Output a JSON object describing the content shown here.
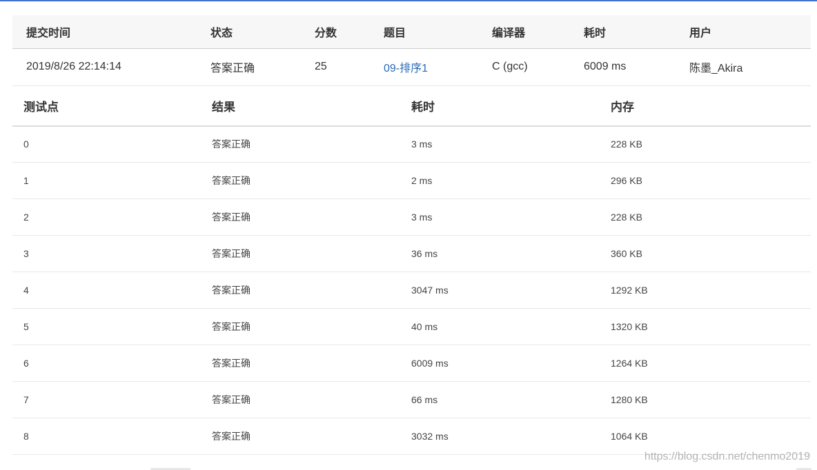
{
  "submission": {
    "headers": {
      "time": "提交时间",
      "status": "状态",
      "score": "分数",
      "problem": "题目",
      "compiler": "编译器",
      "elapsed": "耗时",
      "user": "用户"
    },
    "row": {
      "time": "2019/8/26 22:14:14",
      "status": "答案正确",
      "score": "25",
      "problem": "09-排序1",
      "compiler": "C (gcc)",
      "elapsed": "6009 ms",
      "user": "陈墨_Akira"
    }
  },
  "testcases": {
    "headers": {
      "case": "测试点",
      "result": "结果",
      "time": "耗时",
      "memory": "内存"
    },
    "rows": [
      {
        "case": "0",
        "result": "答案正确",
        "time": "3 ms",
        "memory": "228 KB"
      },
      {
        "case": "1",
        "result": "答案正确",
        "time": "2 ms",
        "memory": "296 KB"
      },
      {
        "case": "2",
        "result": "答案正确",
        "time": "3 ms",
        "memory": "228 KB"
      },
      {
        "case": "3",
        "result": "答案正确",
        "time": "36 ms",
        "memory": "360 KB"
      },
      {
        "case": "4",
        "result": "答案正确",
        "time": "3047 ms",
        "memory": "1292 KB"
      },
      {
        "case": "5",
        "result": "答案正确",
        "time": "40 ms",
        "memory": "1320 KB"
      },
      {
        "case": "6",
        "result": "答案正确",
        "time": "6009 ms",
        "memory": "1264 KB"
      },
      {
        "case": "7",
        "result": "答案正确",
        "time": "66 ms",
        "memory": "1280 KB"
      },
      {
        "case": "8",
        "result": "答案正确",
        "time": "3032 ms",
        "memory": "1064 KB"
      }
    ]
  },
  "watermark": "https://blog.csdn.net/chenmo2019",
  "colors": {
    "accepted": "#e1443b",
    "link": "#2a6bb7",
    "header_bg": "#f7f7f7",
    "top_accent": "#3f6fcf"
  }
}
